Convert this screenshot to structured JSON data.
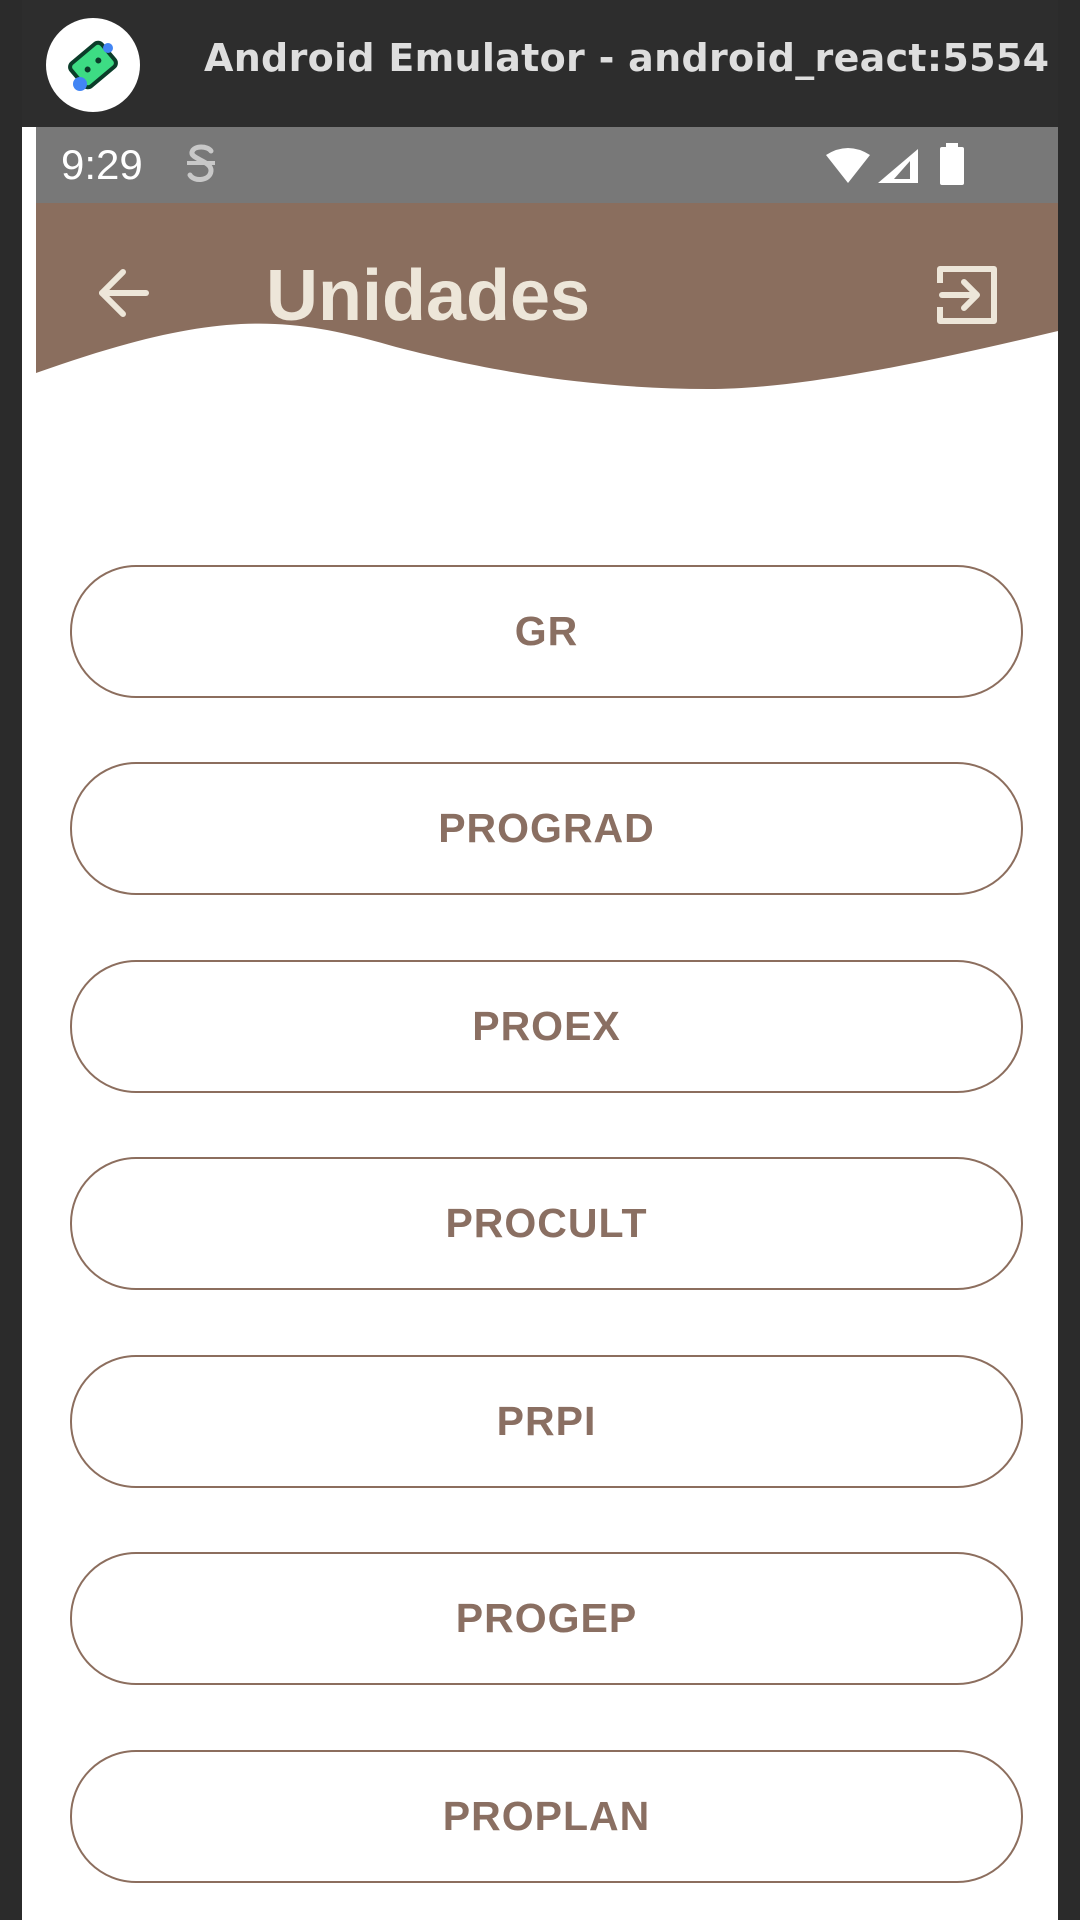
{
  "window": {
    "title": "Android Emulator - android_react:5554",
    "logo_icon": "android-emulator-logo-icon"
  },
  "status_bar": {
    "time": "9:29",
    "icons": [
      "s-notification-icon",
      "wifi-icon",
      "cell-signal-icon",
      "battery-icon"
    ]
  },
  "header": {
    "title": "Unidades",
    "back_icon": "arrow-left-icon",
    "logout_icon": "logout-icon",
    "background_color": "#8a6e5e",
    "title_color": "#ede6d9"
  },
  "units": [
    {
      "label": "GR"
    },
    {
      "label": "PROGRAD"
    },
    {
      "label": "PROEX"
    },
    {
      "label": "PROCULT"
    },
    {
      "label": "PRPI"
    },
    {
      "label": "PROGEP"
    },
    {
      "label": "PROPLAN"
    }
  ],
  "colors": {
    "accent": "#8a6e5e",
    "button_border": "#8c6e5e",
    "button_text": "#8a6f62",
    "status_bar": "#787878",
    "titlebar": "#2d2d2d"
  }
}
